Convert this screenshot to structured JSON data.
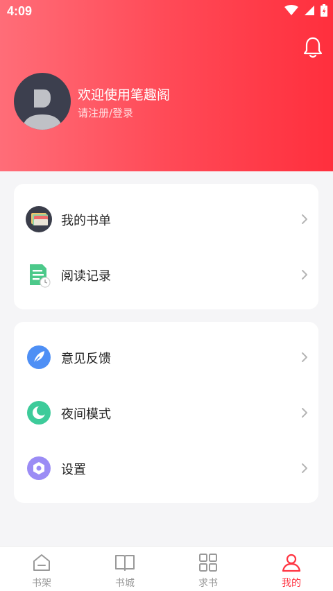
{
  "status_bar": {
    "time": "4:09"
  },
  "profile": {
    "welcome": "欢迎使用笔趣阁",
    "login_hint": "请注册/登录"
  },
  "menu_group_1": [
    {
      "label": "我的书单",
      "icon": "booklist-icon"
    },
    {
      "label": "阅读记录",
      "icon": "reading-history-icon"
    }
  ],
  "menu_group_2": [
    {
      "label": "意见反馈",
      "icon": "feedback-icon"
    },
    {
      "label": "夜间模式",
      "icon": "night-mode-icon"
    },
    {
      "label": "设置",
      "icon": "settings-icon"
    }
  ],
  "tabs": [
    {
      "label": "书架",
      "icon": "bookshelf-icon"
    },
    {
      "label": "书城",
      "icon": "bookstore-icon"
    },
    {
      "label": "求书",
      "icon": "request-book-icon"
    },
    {
      "label": "我的",
      "icon": "profile-icon"
    }
  ],
  "colors": {
    "accent": "#ff3340",
    "header_start": "#ff6d78",
    "header_end": "#ff2f3d"
  }
}
